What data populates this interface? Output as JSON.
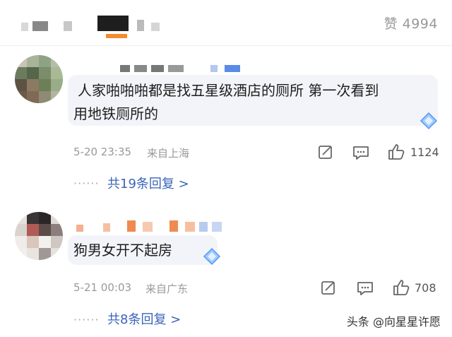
{
  "header": {
    "like_label": "赞 4994"
  },
  "comments": [
    {
      "text": "人家啪啪啪都是找五星级酒店的厕所  第一次看到用地铁厕所的",
      "line1": "人家啪啪啪都是找五星级酒店的厕所  第一次看到",
      "line2": "用地铁厕所的",
      "time": "5-20 23:35",
      "location": "来自上海",
      "likes": "1124",
      "replies": "共19条回复 >"
    },
    {
      "text": "狗男女开不起房",
      "time": "5-21 00:03",
      "location": "来自广东",
      "likes": "708",
      "replies": "共8条回复 >"
    }
  ],
  "watermark": "头条 @向星星许愿",
  "icons": {
    "share": "share-icon",
    "comment": "comment-icon",
    "like": "thumbs-up-icon",
    "badge": "diamond-badge-icon"
  },
  "colors": {
    "reply_link": "#3a64b8",
    "meta_text": "#999999",
    "bubble_bg": "#f2f4f9"
  }
}
